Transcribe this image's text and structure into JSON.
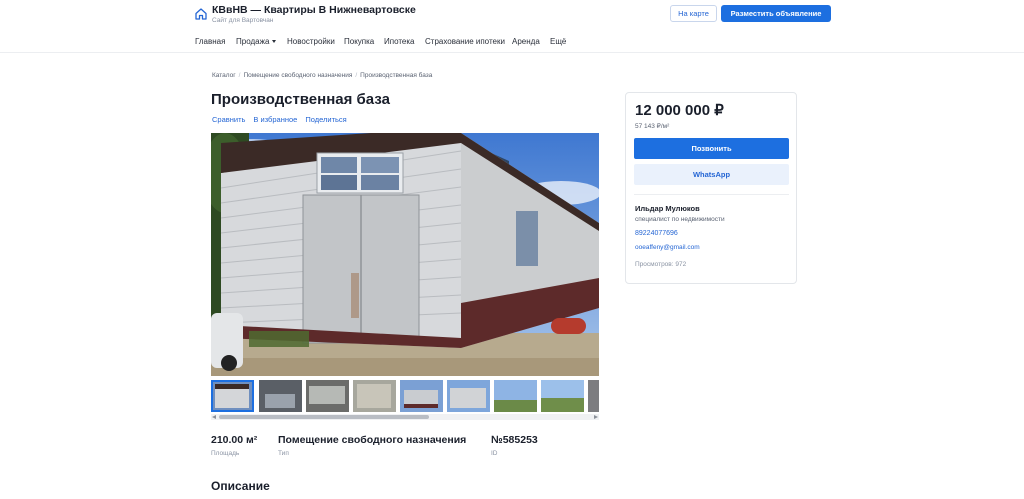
{
  "header": {
    "site_title": "КВвНВ — Квартиры В Нижневартовске",
    "site_subtitle": "Сайт для Вартовчан",
    "map_button": "На карте",
    "post_button": "Разместить объявление"
  },
  "nav": {
    "items": [
      {
        "label": "Главная"
      },
      {
        "label": "Продажа"
      },
      {
        "label": "Новостройки"
      },
      {
        "label": "Покупка"
      },
      {
        "label": "Ипотека"
      },
      {
        "label": "Страхование ипотеки"
      },
      {
        "label": "Аренда"
      },
      {
        "label": "Ещё"
      }
    ]
  },
  "breadcrumb": [
    "Каталог",
    "Помещение свободного назначения",
    "Производственная база"
  ],
  "listing": {
    "title": "Производственная база",
    "actions": [
      "Сравнить",
      "В избранное",
      "Поделиться"
    ],
    "facts": [
      {
        "value": "210.00 м²",
        "label": "Площадь"
      },
      {
        "value": "Помещение свободного назначения",
        "label": "Тип"
      },
      {
        "value": "№585253",
        "label": "ID"
      }
    ],
    "description_title": "Описание"
  },
  "gallery": {
    "thumbnail_count": 9,
    "active_index": 0,
    "scroll_position": 0.0
  },
  "sidebar": {
    "price": "12 000 000 ₽",
    "price_per_m2": "57 143 ₽/м²",
    "call_button": "Позвонить",
    "whatsapp_button": "WhatsApp",
    "agent_name": "Ильдар Мулюков",
    "agent_role": "специалист по недвижимости",
    "agent_phone": "89224077696",
    "agent_email": "ooeaffeny@gmail.com",
    "views": "Просмотров: 972"
  },
  "colors": {
    "accent": "#1d6fe0",
    "link": "#2566d4",
    "text": "#1a1f2b",
    "muted": "#8a93a3"
  }
}
